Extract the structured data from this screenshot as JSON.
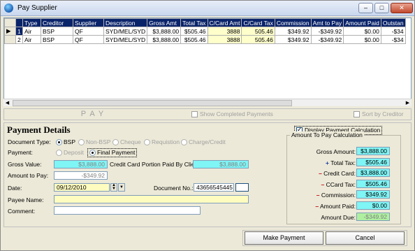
{
  "window": {
    "title": "Pay Supplier",
    "minimize": "–",
    "maximize": "□",
    "close": "✕"
  },
  "grid": {
    "columns": [
      "Type",
      "Creditor",
      "Supplier",
      "Description",
      "Gross Amt",
      "Total Tax",
      "C/Card Amt",
      "C/Card Tax",
      "Commission",
      "Amt to Pay",
      "Amount Paid",
      "Outstan"
    ],
    "rows": [
      {
        "num": "1",
        "type": "Air",
        "creditor": "BSP",
        "supplier": "QF",
        "description": "SYD/MEL/SYD",
        "gross": "$3,888.00",
        "tax": "$505.46",
        "ccamt": "3888",
        "cctax": "505.46",
        "commission": "$349.92",
        "amttopay": "-$349.92",
        "paid": "$0.00",
        "outstanding": "-$34"
      },
      {
        "num": "2",
        "type": "Air",
        "creditor": "BSP",
        "supplier": "QF",
        "description": "SYD/MEL/SYD",
        "gross": "$3,888.00",
        "tax": "$505.46",
        "ccamt": "3888",
        "cctax": "505.46",
        "commission": "$349.92",
        "amttopay": "-$349.92",
        "paid": "$0.00",
        "outstanding": "-$34"
      }
    ],
    "row_indicator": "▶"
  },
  "scroll": {
    "left": "◀",
    "right": "▶"
  },
  "paybar": {
    "pay_label": "PAY",
    "show_completed": "Show Completed Payments",
    "sort_by_creditor": "Sort by Creditor"
  },
  "details": {
    "title": "Payment Details",
    "doc_type_label": "Document Type:",
    "doc_types": [
      "BSP",
      "Non-BSP",
      "Cheque",
      "Requistion",
      "Charge/Credit"
    ],
    "payment_label": "Payment:",
    "payment_types": [
      "Deposit",
      "Final Payment"
    ],
    "gross_label": "Gross Value:",
    "gross_value": "$3,888.00",
    "cc_portion_label": "Credit Card Portion Paid By Client:",
    "cc_portion_value": "$3,888.00",
    "amount_to_pay_label": "Amount to Pay:",
    "amount_to_pay_value": "-$349.92",
    "date_label": "Date:",
    "date_value": "09/12/2010",
    "doc_no_label": "Document No.:",
    "doc_no_value": "43656545445",
    "payee_label": "Payee Name:",
    "payee_value": "",
    "comment_label": "Comment:",
    "comment_value": ""
  },
  "calc": {
    "display_label": "Display Payment Calculation",
    "group_title": "Amount To Pay Calculation",
    "rows": [
      {
        "sym": "",
        "label": "Gross Amount:",
        "value": "$3,888.00"
      },
      {
        "sym": "+",
        "label": "Total Tax:",
        "value": "$505.46"
      },
      {
        "sym": "–",
        "label": "Credit Card:",
        "value": "$3,888.00"
      },
      {
        "sym": "–",
        "label": "CCard Tax:",
        "value": "$505.46"
      },
      {
        "sym": "–",
        "label": "Commission:",
        "value": "$349.92"
      },
      {
        "sym": "–",
        "label": "Amount Paid:",
        "value": "$0.00"
      },
      {
        "sym": "",
        "label": "Amount Due:",
        "value": "-$349.92"
      }
    ]
  },
  "buttons": {
    "make_payment": "Make Payment",
    "cancel": "Cancel"
  }
}
